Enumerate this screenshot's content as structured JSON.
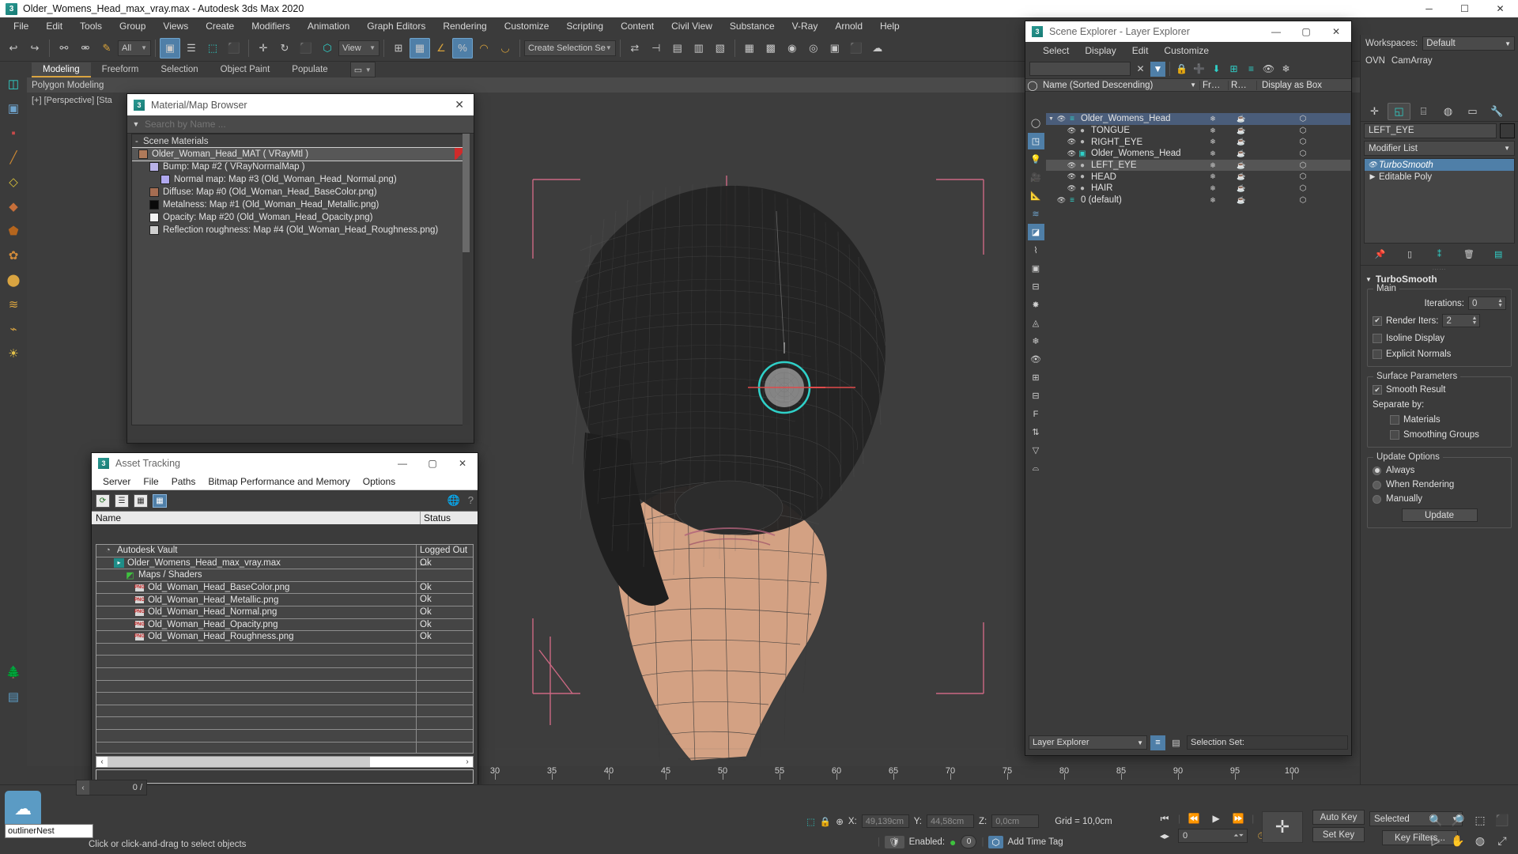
{
  "window": {
    "title": "Older_Womens_Head_max_vray.max - Autodesk 3ds Max 2020",
    "app_icon": "3ds-max-icon",
    "minimize": "─",
    "maximize": "☐",
    "close": "✕"
  },
  "menubar": {
    "items": [
      "File",
      "Edit",
      "Tools",
      "Group",
      "Views",
      "Create",
      "Modifiers",
      "Animation",
      "Graph Editors",
      "Rendering",
      "Customize",
      "Scripting",
      "Content",
      "Civil View",
      "Substance",
      "V-Ray",
      "Arnold",
      "Help"
    ]
  },
  "main_toolbar": {
    "selection_filter": "All",
    "view_dropdown": "View",
    "named_selection": "Create Selection Se",
    "buttons": [
      "undo",
      "redo",
      "link",
      "unlink",
      "bind-space-warp",
      "select-object",
      "select-by-name",
      "rect-select",
      "fence-select",
      "move",
      "rotate",
      "scale",
      "ref-coord",
      "snap-toggle",
      "angle-snap",
      "percent-snap",
      "spinner-snap",
      "mirror",
      "align",
      "layer-manager",
      "curve-editor",
      "schematic-view",
      "material-editor",
      "render-setup",
      "render-frame",
      "render-production"
    ]
  },
  "ribbon": {
    "tabs": [
      "Modeling",
      "Freeform",
      "Selection",
      "Object Paint",
      "Populate"
    ],
    "active_tab": "Modeling",
    "subtitle": "Polygon Modeling"
  },
  "viewport": {
    "label": "[+] [Perspective] [Sta",
    "model_name": "Older_Womens_Head"
  },
  "material_browser": {
    "title": "Material/Map Browser",
    "search_placeholder": "Search by Name ...",
    "group_label": "Scene Materials",
    "rows": [
      {
        "label": "Older_Woman_Head_MAT  ( VRayMtl )",
        "indent": 0,
        "swatch": "#b07a5a",
        "selected": true
      },
      {
        "label": "Bump: Map #2  ( VRayNormalMap )",
        "indent": 1,
        "swatch": "#b9b2e8",
        "selected": false
      },
      {
        "label": "Normal map: Map #3 (Old_Woman_Head_Normal.png)",
        "indent": 2,
        "swatch": "#b0a8ef",
        "selected": false
      },
      {
        "label": "Diffuse: Map #0 (Old_Woman_Head_BaseColor.png)",
        "indent": 1,
        "swatch": "#a56d52",
        "selected": false
      },
      {
        "label": "Metalness: Map #1 (Old_Woman_Head_Metallic.png)",
        "indent": 1,
        "swatch": "#0a0a0a",
        "selected": false
      },
      {
        "label": "Opacity: Map #20 (Old_Woman_Head_Opacity.png)",
        "indent": 1,
        "swatch": "#f2f2f2",
        "selected": false
      },
      {
        "label": "Reflection roughness: Map #4 (Old_Woman_Head_Roughness.png)",
        "indent": 1,
        "swatch": "#cfcfcf",
        "selected": false
      }
    ]
  },
  "asset_tracking": {
    "title": "Asset Tracking",
    "menu": [
      "Server",
      "File",
      "Paths",
      "Bitmap Performance and Memory",
      "Options"
    ],
    "toolbar_buttons": [
      "refresh-icon",
      "list-view-icon",
      "detail-view-icon",
      "grid-view-icon",
      "help-globe-icon",
      "help-icon"
    ],
    "columns": {
      "name": "Name",
      "status": "Status"
    },
    "rows": [
      {
        "name": "Autodesk Vault",
        "status": "Logged Out ...",
        "indent": 0,
        "icon": "vault-icon"
      },
      {
        "name": "Older_Womens_Head_max_vray.max",
        "status": "Ok",
        "indent": 1,
        "icon": "max-icon"
      },
      {
        "name": "Maps / Shaders",
        "status": "",
        "indent": 2,
        "icon": "shader-icon"
      },
      {
        "name": "Old_Woman_Head_BaseColor.png",
        "status": "Ok",
        "indent": 3,
        "icon": "png-icon"
      },
      {
        "name": "Old_Woman_Head_Metallic.png",
        "status": "Ok",
        "indent": 3,
        "icon": "png-icon"
      },
      {
        "name": "Old_Woman_Head_Normal.png",
        "status": "Ok",
        "indent": 3,
        "icon": "png-icon"
      },
      {
        "name": "Old_Woman_Head_Opacity.png",
        "status": "Ok",
        "indent": 3,
        "icon": "png-icon"
      },
      {
        "name": "Old_Woman_Head_Roughness.png",
        "status": "Ok",
        "indent": 3,
        "icon": "png-icon"
      }
    ]
  },
  "scene_explorer": {
    "title": "Scene Explorer - Layer Explorer",
    "menu": [
      "Select",
      "Display",
      "Edit",
      "Customize"
    ],
    "search_value": "",
    "columns": {
      "name": "Name (Sorted Descending)",
      "frozen": "Fr…",
      "render": "R…",
      "display": "Display as Box"
    },
    "rows": [
      {
        "name": "Older_Womens_Head",
        "indent": 0,
        "type": "layer",
        "selected": true,
        "expanded": true
      },
      {
        "name": "TONGUE",
        "indent": 1,
        "type": "object",
        "selected": false
      },
      {
        "name": "RIGHT_EYE",
        "indent": 1,
        "type": "object",
        "selected": false
      },
      {
        "name": "Older_Womens_Head",
        "indent": 1,
        "type": "object-highlight",
        "selected": false
      },
      {
        "name": "LEFT_EYE",
        "indent": 1,
        "type": "object",
        "selected": false,
        "highlight": true
      },
      {
        "name": "HEAD",
        "indent": 1,
        "type": "object",
        "selected": false
      },
      {
        "name": "HAIR",
        "indent": 1,
        "type": "object",
        "selected": false
      },
      {
        "name": "0 (default)",
        "indent": 0,
        "type": "layer",
        "selected": false
      }
    ],
    "footer": {
      "layer_dropdown": "Layer Explorer",
      "selection_set_label": "Selection Set:"
    }
  },
  "command_panel": {
    "workspace_label": "Workspaces:",
    "workspace_value": "Default",
    "overlay_label": "OVN",
    "camera_label": "CamArray",
    "tabs": [
      "create-tab",
      "modify-tab",
      "hierarchy-tab",
      "motion-tab",
      "display-tab",
      "utilities-tab"
    ],
    "active_tab_index": 1,
    "object_name": "LEFT_EYE",
    "modifier_list_label": "Modifier List",
    "stack": [
      {
        "label": "TurboSmooth",
        "selected": true
      },
      {
        "label": "Editable Poly",
        "selected": false
      }
    ],
    "rollout_title": "TurboSmooth",
    "main_group": {
      "label": "Main",
      "iterations_label": "Iterations:",
      "iterations_value": "0",
      "render_iters_label": "Render Iters:",
      "render_iters_value": "2",
      "render_iters_checked": true,
      "isoline_label": "Isoline Display",
      "isoline_checked": false,
      "explicit_label": "Explicit Normals",
      "explicit_checked": false
    },
    "surface_group": {
      "label": "Surface Parameters",
      "smooth_result_label": "Smooth Result",
      "smooth_result_checked": true,
      "separate_by_label": "Separate by:",
      "materials_label": "Materials",
      "materials_checked": false,
      "smoothing_groups_label": "Smoothing Groups",
      "smoothing_groups_checked": false
    },
    "update_group": {
      "label": "Update Options",
      "options": [
        "Always",
        "When Rendering",
        "Manually"
      ],
      "selected": "Always",
      "update_button": "Update"
    }
  },
  "timeline": {
    "current_frame_display": "0 /",
    "ticks": [
      30,
      35,
      40,
      45,
      50,
      55,
      60,
      65,
      70,
      75,
      80,
      85,
      90,
      95,
      100
    ]
  },
  "status_bar": {
    "hint": "Click or click-and-drag to select objects",
    "x_label": "X:",
    "x_value": "49,139cm",
    "y_label": "Y:",
    "y_value": "44,58cm",
    "z_label": "Z:",
    "z_value": "0,0cm",
    "grid_label": "Grid = 10,0cm",
    "enabled_label": "Enabled:",
    "enabled_count": "0",
    "add_time_tag": "Add Time Tag",
    "frame_field": "0",
    "auto_key": "Auto Key",
    "set_key": "Set Key",
    "key_mode_value": "Selected",
    "key_filters": "Key Filters...",
    "outliner_tooltip": "outlinerNest"
  }
}
